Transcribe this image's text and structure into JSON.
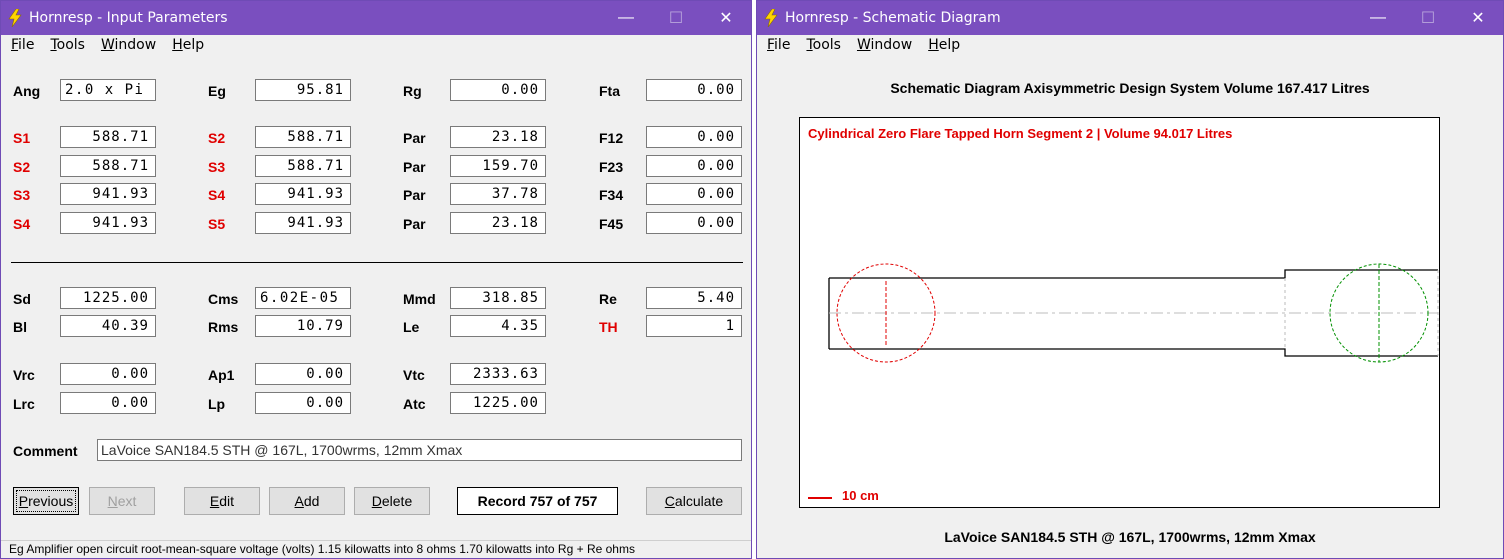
{
  "input_window": {
    "title": "Hornresp - Input Parameters",
    "controls": {
      "minimize": "—",
      "maximize": "☐",
      "close": "✕"
    },
    "menu": [
      {
        "label": "File",
        "accel": "F",
        "rest": "ile"
      },
      {
        "label": "Tools",
        "accel": "T",
        "rest": "ools"
      },
      {
        "label": "Window",
        "accel": "W",
        "rest": "indow"
      },
      {
        "label": "Help",
        "accel": "H",
        "rest": "elp"
      }
    ],
    "params": {
      "ang": {
        "label": "Ang",
        "value": "2.0 x Pi"
      },
      "eg": {
        "label": "Eg",
        "value": "95.81"
      },
      "rg": {
        "label": "Rg",
        "value": "0.00"
      },
      "fta": {
        "label": "Fta",
        "value": "0.00"
      },
      "r1": {
        "l1": "S1",
        "v1": "588.71",
        "l2": "S2",
        "v2": "588.71",
        "l3": "Par",
        "v3": "23.18",
        "l4": "F12",
        "v4": "0.00"
      },
      "r2": {
        "l1": "S2",
        "v1": "588.71",
        "l2": "S3",
        "v2": "588.71",
        "l3": "Par",
        "v3": "159.70",
        "l4": "F23",
        "v4": "0.00"
      },
      "r3": {
        "l1": "S3",
        "v1": "941.93",
        "l2": "S4",
        "v2": "941.93",
        "l3": "Par",
        "v3": "37.78",
        "l4": "F34",
        "v4": "0.00"
      },
      "r4": {
        "l1": "S4",
        "v1": "941.93",
        "l2": "S5",
        "v2": "941.93",
        "l3": "Par",
        "v3": "23.18",
        "l4": "F45",
        "v4": "0.00"
      },
      "sd": {
        "label": "Sd",
        "value": "1225.00"
      },
      "cms": {
        "label": "Cms",
        "value": "6.02E-05"
      },
      "mmd": {
        "label": "Mmd",
        "value": "318.85"
      },
      "re": {
        "label": "Re",
        "value": "5.40"
      },
      "bl": {
        "label": "Bl",
        "value": "40.39"
      },
      "rms": {
        "label": "Rms",
        "value": "10.79"
      },
      "le": {
        "label": "Le",
        "value": "4.35"
      },
      "th": {
        "label": "TH",
        "value": "1"
      },
      "vrc": {
        "label": "Vrc",
        "value": "0.00"
      },
      "ap1": {
        "label": "Ap1",
        "value": "0.00"
      },
      "vtc": {
        "label": "Vtc",
        "value": "2333.63"
      },
      "lrc": {
        "label": "Lrc",
        "value": "0.00"
      },
      "lp": {
        "label": "Lp",
        "value": "0.00"
      },
      "atc": {
        "label": "Atc",
        "value": "1225.00"
      }
    },
    "comment": {
      "label": "Comment",
      "value": "LaVoice SAN184.5 STH @ 167L, 1700wrms, 12mm Xmax"
    },
    "buttons": {
      "previous": {
        "accel": "P",
        "rest": "revious"
      },
      "next": {
        "accel": "N",
        "rest": "ext"
      },
      "edit": {
        "accel": "E",
        "rest": "dit"
      },
      "add": {
        "accel": "A",
        "rest": "dd"
      },
      "delete": {
        "accel": "D",
        "rest": "elete"
      },
      "calculate": {
        "accel": "C",
        "rest": "alculate"
      }
    },
    "record": "Record 757 of 757",
    "status": "Eg   Amplifier open circuit root-mean-square voltage  (volts)   1.15 kilowatts into 8 ohms   1.70 kilowatts into Rg + Re ohms"
  },
  "schematic_window": {
    "title": "Hornresp - Schematic Diagram",
    "controls": {
      "minimize": "—",
      "maximize": "☐",
      "close": "✕"
    },
    "menu": [
      {
        "label": "File",
        "accel": "F",
        "rest": "ile"
      },
      {
        "label": "Tools",
        "accel": "T",
        "rest": "ools"
      },
      {
        "label": "Window",
        "accel": "W",
        "rest": "indow"
      },
      {
        "label": "Help",
        "accel": "H",
        "rest": "elp"
      }
    ],
    "header": "Schematic Diagram   Axisymmetric Design   System Volume 167.417 Litres",
    "diagram_title": "Cylindrical Zero Flare Tapped Horn Segment 2 | Volume 94.017 Litres",
    "scale_label": "10 cm",
    "footer": "LaVoice SAN184.5 STH @ 167L, 1700wrms, 12mm Xmax",
    "colors": {
      "driver_left": "#e00000",
      "driver_right": "#009000",
      "accent": "#7a4fbf"
    }
  }
}
